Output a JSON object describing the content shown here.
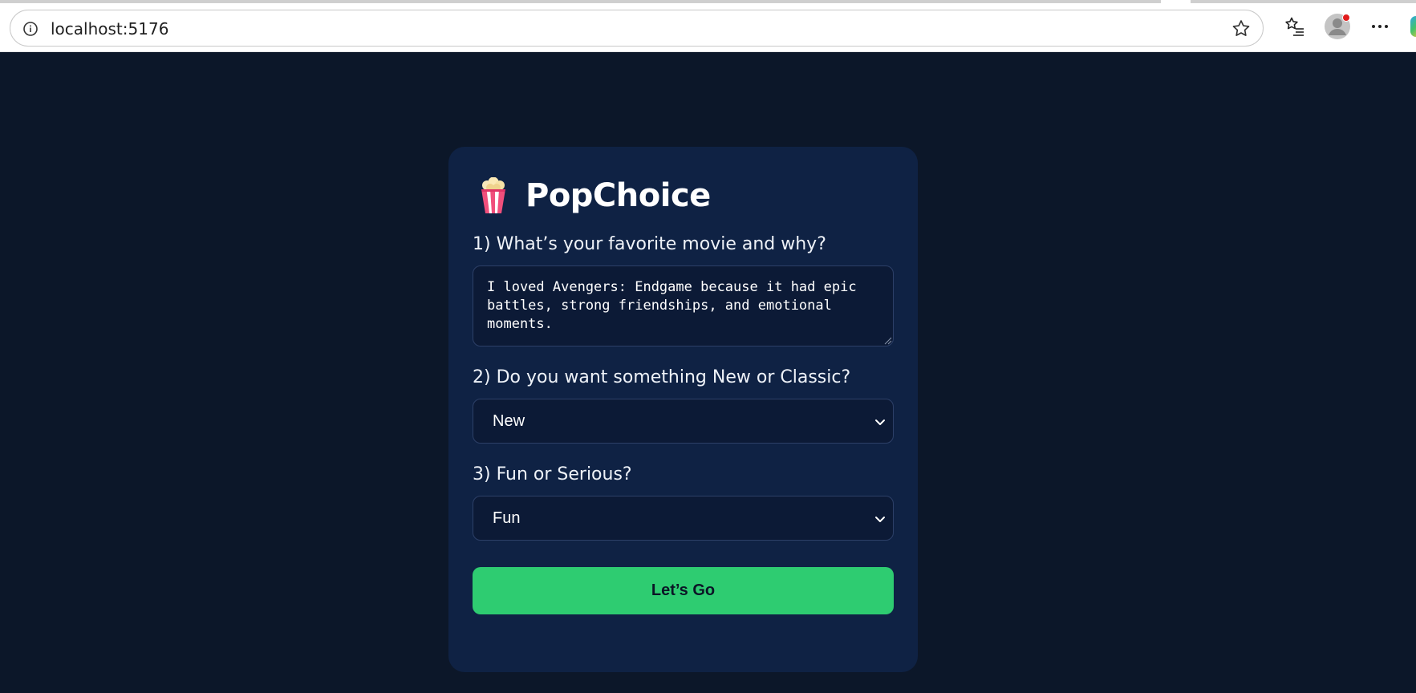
{
  "browser": {
    "url": "localhost:5176"
  },
  "app": {
    "title": "PopChoice",
    "logo_icon": "popcorn-icon"
  },
  "questions": {
    "q1": {
      "label": "1) What’s your favorite movie and why?",
      "value": "I loved Avengers: Endgame because it had epic battles, strong friendships, and emotional moments."
    },
    "q2": {
      "label": "2) Do you want something New or Classic?",
      "selected": "New"
    },
    "q3": {
      "label": "3) Fun or Serious?",
      "selected": "Fun"
    }
  },
  "submit": {
    "label": "Let’s Go"
  },
  "colors": {
    "page_background": "#0c1729",
    "card_background": "#0f2244",
    "accent_button": "#2ecc71",
    "field_background": "#0c1a36"
  }
}
